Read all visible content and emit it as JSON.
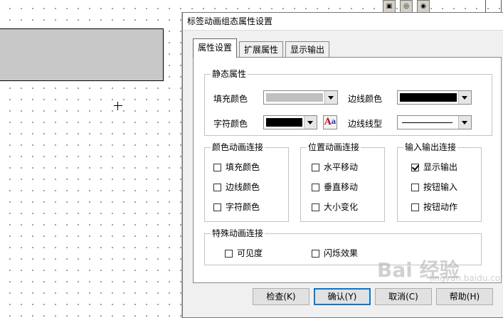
{
  "dialog": {
    "title": "标签动画组态属性设置",
    "tabs": [
      {
        "label": "属性设置",
        "active": true
      },
      {
        "label": "扩展属性",
        "active": false
      },
      {
        "label": "显示输出",
        "active": false
      }
    ]
  },
  "static_props": {
    "legend": "静态属性",
    "fill_color_label": "填充颜色",
    "fill_color": "#c0c0c0",
    "border_color_label": "边线颜色",
    "border_color": "#000000",
    "char_color_label": "字符颜色",
    "char_color": "#000000",
    "font_button_glyph_big": "A",
    "font_button_glyph_small": "a",
    "border_style_label": "边线线型"
  },
  "color_anim": {
    "legend": "颜色动画连接",
    "items": [
      {
        "label": "填充颜色",
        "checked": false
      },
      {
        "label": "边线颜色",
        "checked": false
      },
      {
        "label": "字符颜色",
        "checked": false
      }
    ]
  },
  "pos_anim": {
    "legend": "位置动画连接",
    "items": [
      {
        "label": "水平移动",
        "checked": false
      },
      {
        "label": "垂直移动",
        "checked": false
      },
      {
        "label": "大小变化",
        "checked": false
      }
    ]
  },
  "io_conn": {
    "legend": "输入输出连接",
    "items": [
      {
        "label": "显示输出",
        "checked": true
      },
      {
        "label": "按钮输入",
        "checked": false
      },
      {
        "label": "按钮动作",
        "checked": false
      }
    ]
  },
  "special_anim": {
    "legend": "特殊动画连接",
    "items": [
      {
        "label": "可见度",
        "checked": false
      },
      {
        "label": "闪烁效果",
        "checked": false
      }
    ]
  },
  "buttons": {
    "check": "检查(K)",
    "ok": "确认(Y)",
    "cancel": "取消(C)",
    "help": "帮助(H)"
  },
  "watermark": {
    "main": "Bai 经验",
    "sub": "jingyan.baidu.com"
  }
}
